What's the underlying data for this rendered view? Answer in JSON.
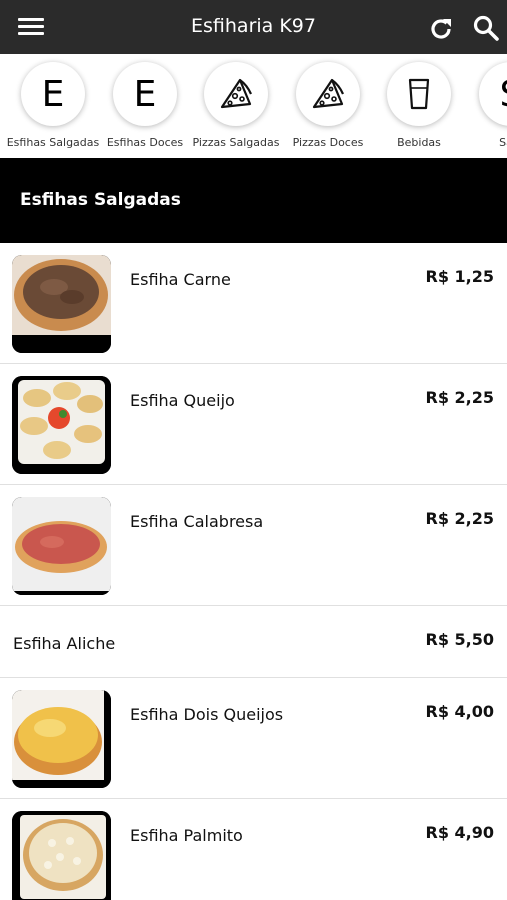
{
  "app": {
    "title": "Esfiharia K97"
  },
  "toolbar": {
    "menu_icon": "hamburger-menu-icon",
    "refresh_icon": "refresh-icon",
    "search_icon": "search-icon"
  },
  "categories": [
    {
      "label": "Esfihas Salgadas",
      "icon": "letter-e",
      "letter": "E"
    },
    {
      "label": "Esfihas Doces",
      "icon": "letter-e",
      "letter": "E"
    },
    {
      "label": "Pizzas Salgadas",
      "icon": "pizza-slice-icon"
    },
    {
      "label": "Pizzas Doces",
      "icon": "pizza-slice-icon"
    },
    {
      "label": "Bebidas",
      "icon": "glass-icon"
    },
    {
      "label": "Salg",
      "icon": "letter-s",
      "letter": "S"
    }
  ],
  "section": {
    "title": "Esfihas Salgadas"
  },
  "items": [
    {
      "name": "Esfiha Carne",
      "price": "R$ 1,25",
      "thumb": "meat-esfiha-photo"
    },
    {
      "name": "Esfiha Queijo",
      "price": "R$ 2,25",
      "thumb": "cheese-esfiha-photo"
    },
    {
      "name": "Esfiha Calabresa",
      "price": "R$ 2,25",
      "thumb": "calabresa-esfiha-photo"
    },
    {
      "name": "Esfiha Aliche",
      "price": "R$ 5,50"
    },
    {
      "name": "Esfiha Dois Queijos",
      "price": "R$ 4,00",
      "thumb": "two-cheese-esfiha-photo"
    },
    {
      "name": "Esfiha Palmito",
      "price": "R$ 4,90",
      "thumb": "palmito-esfiha-photo"
    }
  ]
}
